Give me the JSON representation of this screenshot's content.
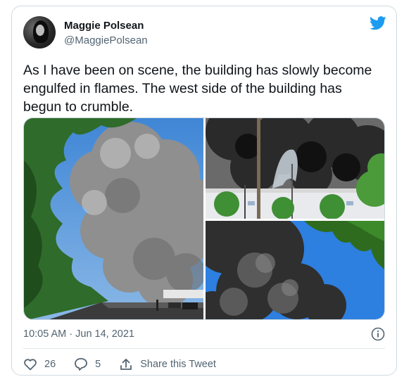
{
  "author": {
    "name": "Maggie Polsean",
    "handle": "@MaggiePolsean"
  },
  "tweet": {
    "text": "As I have been on scene, the building has slowly become engulfed in flames. The west side of the building has begun to crumble.",
    "timestamp": "10:05 AM · Jun 14, 2021"
  },
  "actions": {
    "likes": "26",
    "replies": "5",
    "share_label": "Share this Tweet"
  },
  "icons": {
    "brand": "twitter-bird-icon",
    "info": "info-icon",
    "like": "heart-icon",
    "reply": "reply-icon",
    "share": "share-icon"
  },
  "colors": {
    "brand": "#1d9bf0",
    "text": "#0f1419",
    "secondary": "#536471"
  }
}
